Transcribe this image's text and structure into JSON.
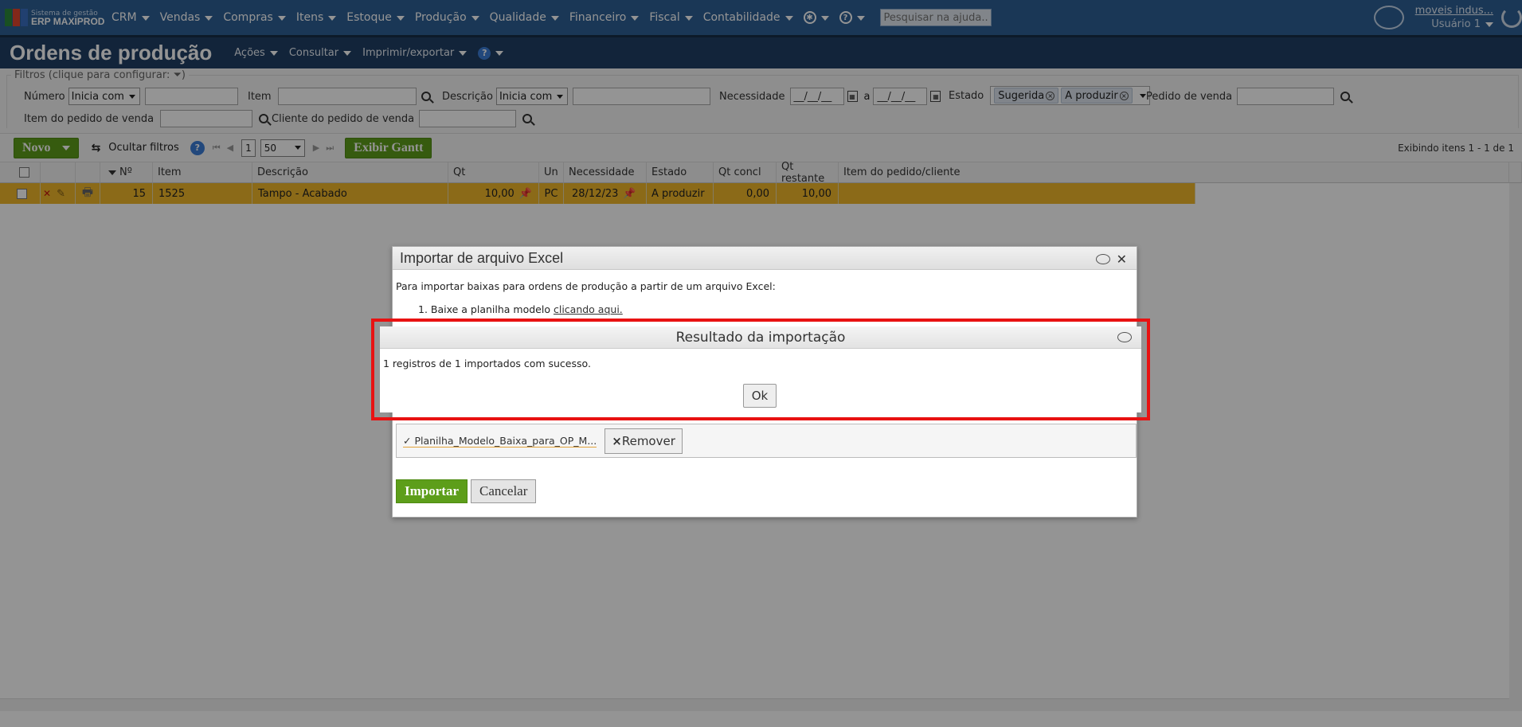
{
  "app": {
    "logo_line1": "Sistema de gestão",
    "logo_line2": "ERP MAXIPROD"
  },
  "topnav": {
    "items": [
      "CRM",
      "Vendas",
      "Compras",
      "Itens",
      "Estoque",
      "Produção",
      "Qualidade",
      "Financeiro",
      "Fiscal",
      "Contabilidade"
    ],
    "help_search_placeholder": "Pesquisar na ajuda...",
    "user_company": "moveis indus...",
    "user_name": "Usuário 1"
  },
  "pagehead": {
    "title": "Ordens de produção",
    "menus": [
      "Ações",
      "Consultar",
      "Imprimir/exportar"
    ],
    "help": "?"
  },
  "filters": {
    "legend": "Filtros (clique para configurar:",
    "numero_label": "Número",
    "numero_op": "Inicia com",
    "item_label": "Item",
    "descricao_label": "Descrição",
    "descricao_op": "Inicia com",
    "necessidade_label": "Necessidade",
    "date_from": "__/__/__",
    "date_sep": "a",
    "date_to": "__/__/__",
    "estado_label": "Estado",
    "estado_tags": [
      "Sugerida",
      "A produzir"
    ],
    "pedido_label": "Pedido de venda",
    "item_pedido_label": "Item do pedido de venda",
    "cliente_label": "Cliente do pedido de venda"
  },
  "toolbar": {
    "novo": "Novo",
    "ocultar": "Ocultar filtros",
    "help": "?",
    "page": "1",
    "page_size": "50",
    "gantt": "Exibir Gantt",
    "exibindo": "Exibindo itens 1 - 1 de 1"
  },
  "grid": {
    "headers": {
      "numero": "Nº",
      "item": "Item",
      "descricao": "Descrição",
      "qt": "Qt",
      "un": "Un",
      "necessidade": "Necessidade",
      "estado": "Estado",
      "qt_concl": "Qt concl",
      "qt_restante": "Qt restante",
      "item_pedido": "Item do pedido/cliente"
    },
    "rows": [
      {
        "numero": "15",
        "item": "1525",
        "descricao": "Tampo - Acabado",
        "qt": "10,00",
        "un": "PC",
        "necessidade": "28/12/23",
        "estado": "A produzir",
        "qt_concl": "0,00",
        "qt_restante": "10,00",
        "item_pedido": ""
      }
    ]
  },
  "import_dialog": {
    "title": "Importar de arquivo Excel",
    "intro": "Para importar baixas para ordens de produção a partir de um arquivo Excel:",
    "step1_prefix": "1. Baixe a planilha modelo",
    "step1_link": "clicando aqui.",
    "file_name": "Planilha_Modelo_Baixa_para_OP_M...",
    "remove": "Remover",
    "import_btn": "Importar",
    "cancel_btn": "Cancelar"
  },
  "result_dialog": {
    "title": "Resultado da importação",
    "message": "1 registros de 1 importados com sucesso.",
    "ok": "Ok"
  },
  "colors": {
    "nav": "#2d5f95",
    "pagehead": "#1f3f64",
    "row_highlight": "#efb72a",
    "green": "#5d9e1a",
    "red_frame": "#e81212"
  }
}
